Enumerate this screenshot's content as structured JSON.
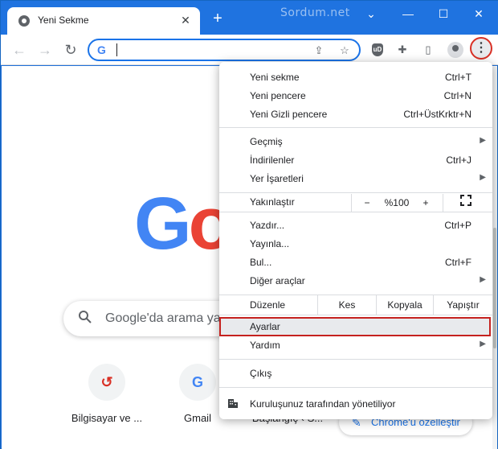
{
  "window": {
    "tab_title": "Yeni Sekme",
    "tab_close": "✕",
    "new_tab": "+",
    "brand": "Sordum.net",
    "minimize": "—",
    "maximize": "☐",
    "close": "✕"
  },
  "toolbar": {
    "back": "←",
    "forward": "→",
    "reload": "↻",
    "omnibox_logo": "G",
    "menu": "⋮"
  },
  "page": {
    "logo_letter_1": "G",
    "logo_letter_2": "o",
    "search_placeholder": "Google'da arama yapın",
    "shortcuts": [
      {
        "label": "Bilgisayar ve ...",
        "glyph": "↺",
        "color": "#d93025"
      },
      {
        "label": "Gmail",
        "glyph": "G",
        "color": "#4285f4"
      },
      {
        "label": "Başlangıç ‹ S..."
      }
    ],
    "customize_label": "Chrome'u özelleştir"
  },
  "menu": {
    "items": {
      "new_tab": {
        "label": "Yeni sekme",
        "shortcut": "Ctrl+T"
      },
      "new_window": {
        "label": "Yeni pencere",
        "shortcut": "Ctrl+N"
      },
      "incognito": {
        "label": "Yeni Gizli pencere",
        "shortcut": "Ctrl+ÜstKrktr+N"
      },
      "history": {
        "label": "Geçmiş"
      },
      "downloads": {
        "label": "İndirilenler",
        "shortcut": "Ctrl+J"
      },
      "bookmarks": {
        "label": "Yer İşaretleri"
      },
      "zoom": {
        "label": "Yakınlaştır",
        "minus": "−",
        "value": "%100",
        "plus": "+"
      },
      "print": {
        "label": "Yazdır...",
        "shortcut": "Ctrl+P"
      },
      "cast": {
        "label": "Yayınla..."
      },
      "find": {
        "label": "Bul...",
        "shortcut": "Ctrl+F"
      },
      "more_tools": {
        "label": "Diğer araçlar"
      },
      "edit": {
        "label": "Düzenle",
        "cut": "Kes",
        "copy": "Kopyala",
        "paste": "Yapıştır"
      },
      "settings": {
        "label": "Ayarlar"
      },
      "help": {
        "label": "Yardım"
      },
      "exit": {
        "label": "Çıkış"
      },
      "managed": {
        "label": "Kuruluşunuz tarafından yönetiliyor"
      }
    }
  }
}
